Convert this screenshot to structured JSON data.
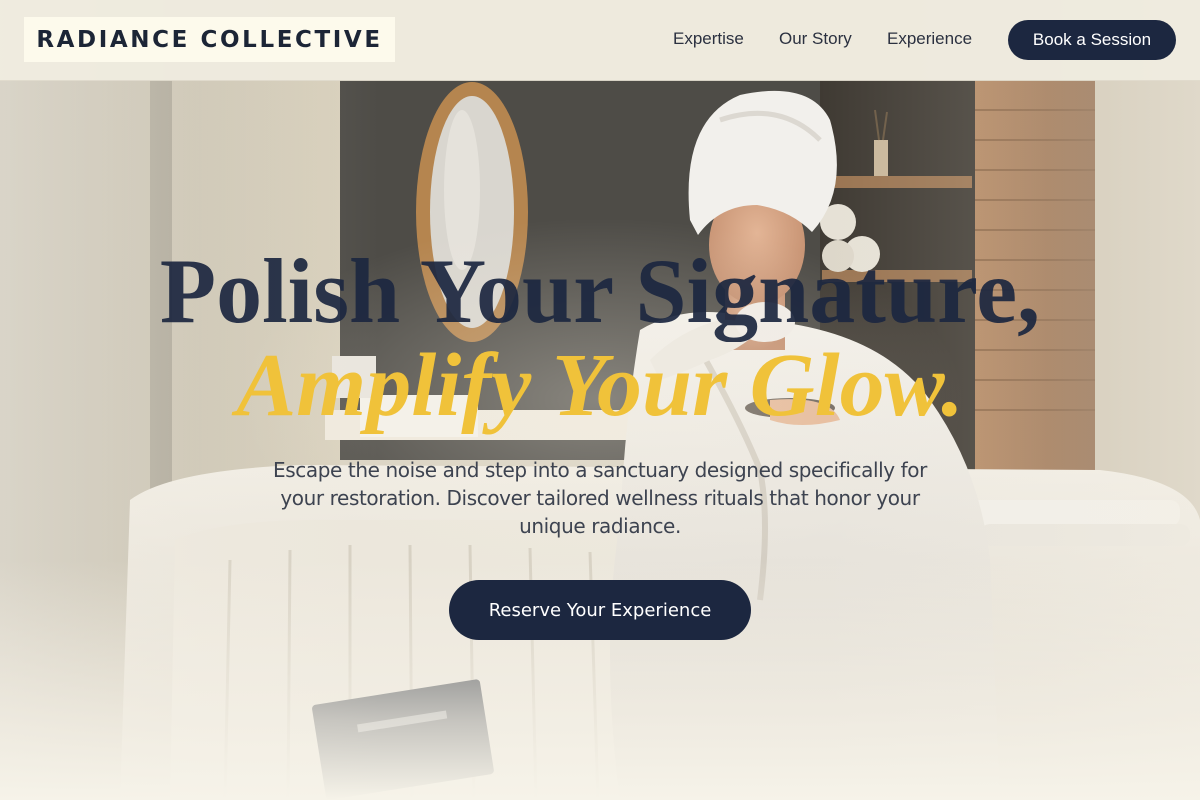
{
  "header": {
    "brand": "RADIANCE COLLECTIVE",
    "nav": [
      {
        "label": "Expertise"
      },
      {
        "label": "Our Story"
      },
      {
        "label": "Experience"
      }
    ],
    "book_button": "Book a Session"
  },
  "hero": {
    "headline_line1": "Polish Your Signature,",
    "headline_line2": "Amplify Your Glow.",
    "subcopy": "Escape the noise and step into a sanctuary designed specifically for your restoration. Discover tailored wellness rituals that honor your unique radiance.",
    "cta_label": "Reserve Your Experience"
  },
  "colors": {
    "navy": "#1c2740",
    "gold": "#f0c23a",
    "cream": "#fdfaec",
    "header_bg": "#f0ece0"
  },
  "icons": []
}
